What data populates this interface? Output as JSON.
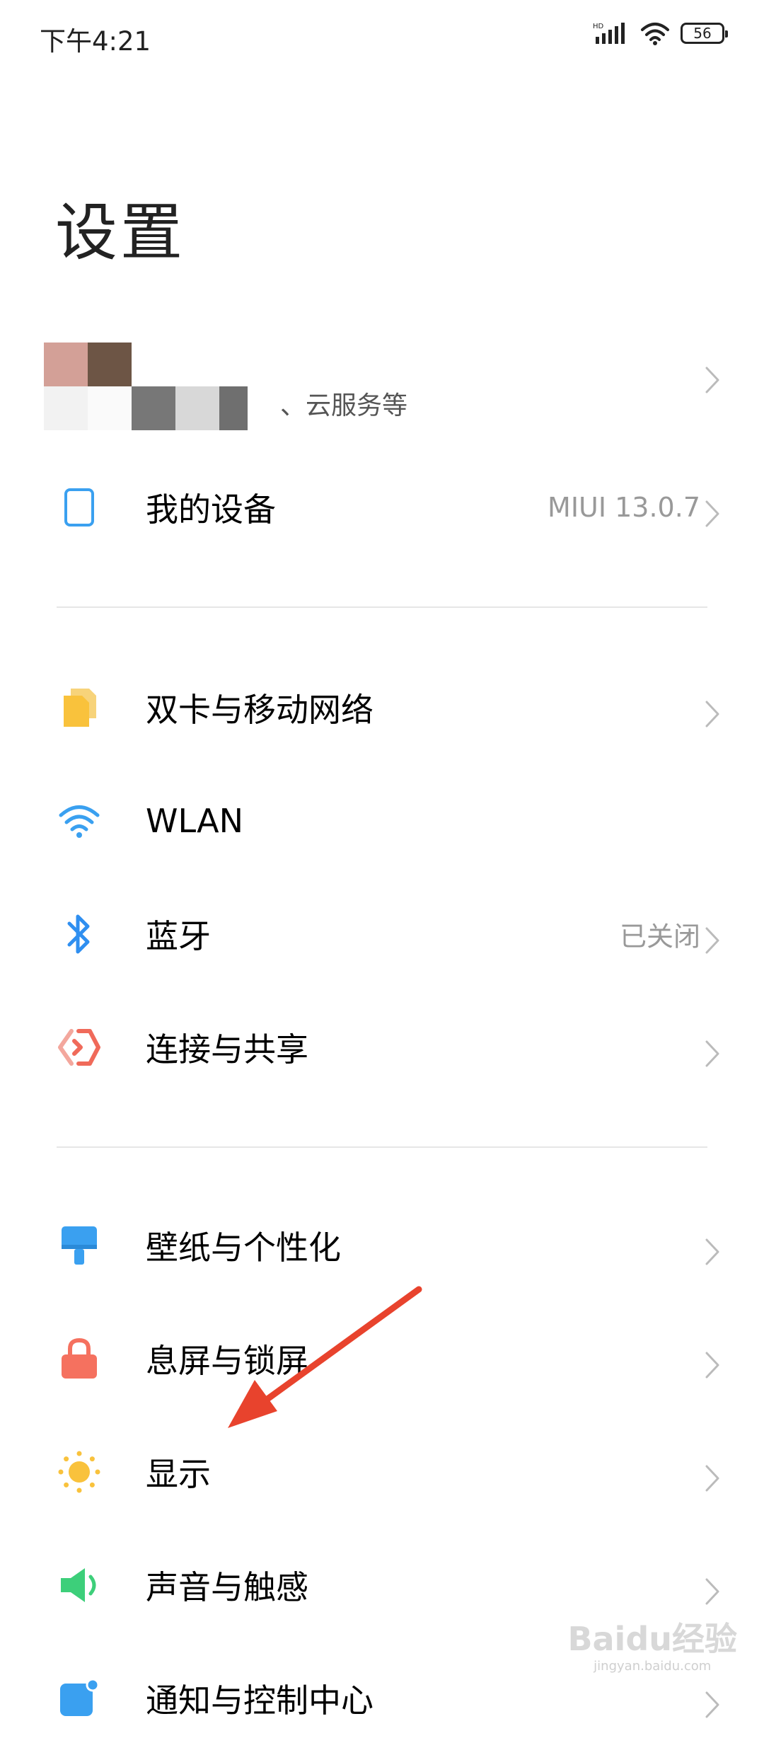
{
  "status": {
    "time": "下午4:21",
    "battery": "56",
    "network": "HD"
  },
  "page": {
    "title": "设置"
  },
  "account": {
    "subtitle": "、云服务等"
  },
  "items": [
    {
      "label": "我的设备",
      "value": "MIUI 13.0.7",
      "icon": "device-icon",
      "color": "#3aa0f0"
    },
    {
      "label": "双卡与移动网络",
      "value": "",
      "icon": "sim-card-icon",
      "color": "#f9c23c"
    },
    {
      "label": "WLAN",
      "value": "",
      "icon": "wifi-icon",
      "color": "#3aa0f0"
    },
    {
      "label": "蓝牙",
      "value": "已关闭",
      "icon": "bluetooth-icon",
      "color": "#2f8ff0"
    },
    {
      "label": "连接与共享",
      "value": "",
      "icon": "connection-sharing-icon",
      "color": "#f06a5a"
    },
    {
      "label": "壁纸与个性化",
      "value": "",
      "icon": "wallpaper-icon",
      "color": "#3aa0f0"
    },
    {
      "label": "息屏与锁屏",
      "value": "",
      "icon": "lock-icon",
      "color": "#f5715f"
    },
    {
      "label": "显示",
      "value": "",
      "icon": "sun-icon",
      "color": "#f9c23c"
    },
    {
      "label": "声音与触感",
      "value": "",
      "icon": "speaker-icon",
      "color": "#3dcf7a"
    },
    {
      "label": "通知与控制中心",
      "value": "",
      "icon": "notification-icon",
      "color": "#3aa0f0"
    }
  ],
  "annotation": {
    "color": "#e8432d"
  },
  "watermark": {
    "brand": "Baidu经验",
    "sub": "jingyan.baidu.com"
  }
}
